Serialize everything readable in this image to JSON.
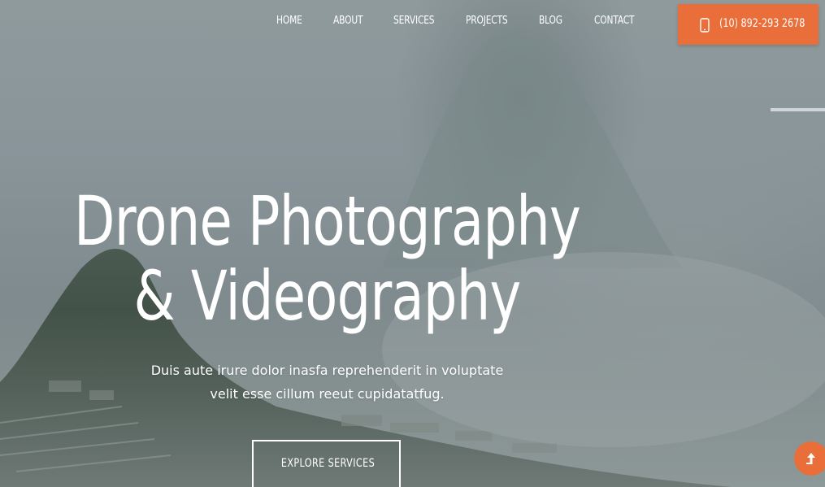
{
  "nav": {
    "items": [
      {
        "label": "HOME"
      },
      {
        "label": "ABOUT"
      },
      {
        "label": "SERVICES"
      },
      {
        "label": "PROJECTS"
      },
      {
        "label": "BLOG"
      },
      {
        "label": "CONTACT"
      }
    ],
    "phone": {
      "label": "(10) 892-293 2678",
      "icon": "mobile-phone-icon"
    }
  },
  "hero": {
    "title_line1": "Drone Photography",
    "title_line2": "& Videography",
    "subtitle_line1": "Duis aute irure dolor inasfa reprehenderit in voluptate",
    "subtitle_line2": "velit esse cillum reeut cupidatatfug.",
    "cta_label": "EXPLORE SERVICES"
  },
  "scroll_top": {
    "icon": "arrow-up-icon"
  },
  "colors": {
    "accent": "#e96e3a",
    "text": "#ffffff"
  }
}
